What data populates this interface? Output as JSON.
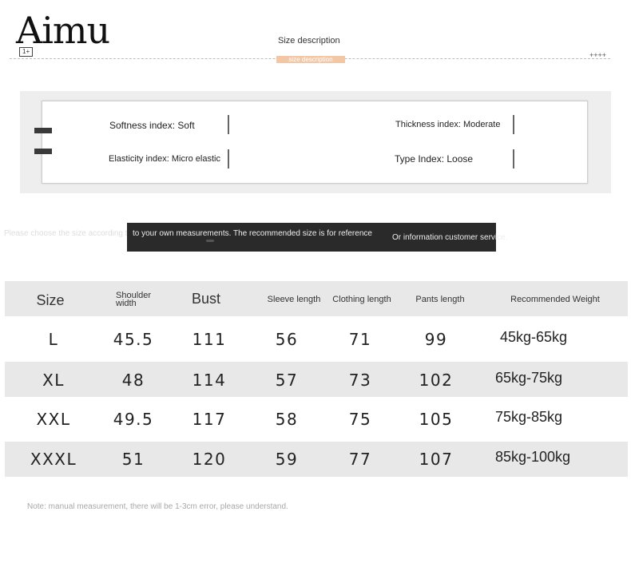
{
  "header": {
    "brand": "Aimu",
    "brand_tag": "1+",
    "section_title": "Size description",
    "section_subtitle": "size description",
    "plus_mark": "++++"
  },
  "indices": [
    {
      "label": "Softness index: Soft"
    },
    {
      "label": "Thickness index: Moderate"
    },
    {
      "label": "Elasticity index: Micro elastic"
    },
    {
      "label": "Type Index: Loose"
    }
  ],
  "notice": {
    "faint": "Please choose the size according to your own measurements. The recommended size is for reference only.",
    "line1": "to your own measurements. The recommended size is for reference",
    "line2": "Or information customer service."
  },
  "table": {
    "headers": [
      "Size",
      "Shoulder width",
      "Bust",
      "Sleeve length",
      "Clothing length",
      "Pants length",
      "Recommended Weight"
    ],
    "rows": [
      [
        "L",
        "45.5",
        "111",
        "56",
        "71",
        "99",
        "45kg-65kg"
      ],
      [
        "XL",
        "48",
        "114",
        "57",
        "73",
        "102",
        "65kg-75kg"
      ],
      [
        "XXL",
        "49.5",
        "117",
        "58",
        "75",
        "105",
        "75kg-85kg"
      ],
      [
        "XXXL",
        "51",
        "120",
        "59",
        "77",
        "107",
        "85kg-100kg"
      ]
    ]
  },
  "footnote": "Note: manual measurement, there will be 1-3cm error, please understand."
}
